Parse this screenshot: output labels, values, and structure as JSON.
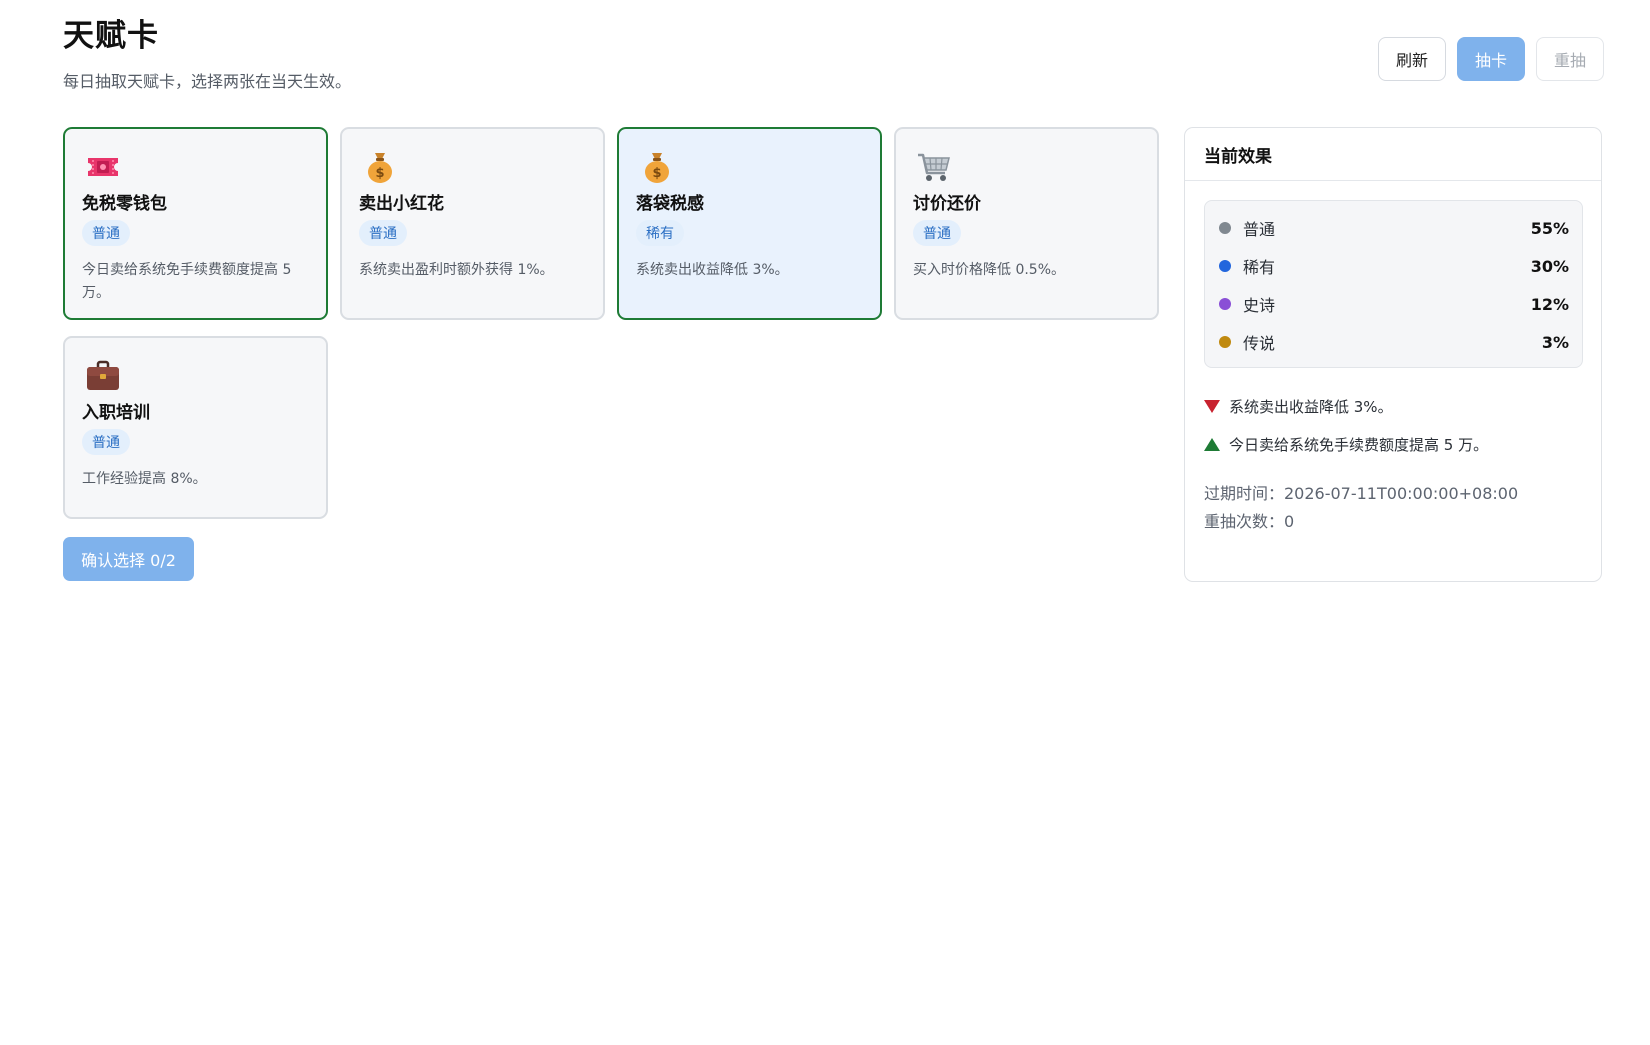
{
  "header": {
    "title": "天赋卡",
    "subtitle": "每日抽取天赋卡，选择两张在当天生效。"
  },
  "toolbar": {
    "refresh_label": "刷新",
    "draw_label": "抽卡",
    "redraw_label": "重抽"
  },
  "cards": [
    {
      "icon": "ticket-icon",
      "name": "免税零钱包",
      "rarity": "普通",
      "desc": "今日卖给系统免手续费额度提高 5 万。",
      "selected": true
    },
    {
      "icon": "money-bag-icon",
      "name": "卖出小红花",
      "rarity": "普通",
      "desc": "系统卖出盈利时额外获得 1%。",
      "selected": false
    },
    {
      "icon": "money-bag-icon",
      "name": "落袋税感",
      "rarity": "稀有",
      "desc": "系统卖出收益降低 3%。",
      "selected": true
    },
    {
      "icon": "shopping-cart-icon",
      "name": "讨价还价",
      "rarity": "普通",
      "desc": "买入时价格降低 0.5%。",
      "selected": false
    },
    {
      "icon": "briefcase-icon",
      "name": "入职培训",
      "rarity": "普通",
      "desc": "工作经验提高 8%。",
      "selected": false
    }
  ],
  "confirm": {
    "label": "确认选择 0/2"
  },
  "effects_panel": {
    "title": "当前效果",
    "odds": [
      {
        "name": "普通",
        "value": "55%",
        "color": "#808890"
      },
      {
        "name": "稀有",
        "value": "30%",
        "color": "#2266dd"
      },
      {
        "name": "史诗",
        "value": "12%",
        "color": "#8a4fd6"
      },
      {
        "name": "传说",
        "value": "3%",
        "color": "#c08a10"
      }
    ],
    "effects": [
      {
        "direction": "down",
        "text": "系统卖出收益降低 3%。"
      },
      {
        "direction": "up",
        "text": "今日卖给系统免手续费额度提高 5 万。"
      }
    ],
    "expire": "过期时间：2026-07-11T00:00:00+08:00",
    "redraw_count": "重抽次数：0"
  },
  "colors": {
    "accent": "#7fb2ec",
    "selected_border": "#1e7b35",
    "badge_bg": "#e3effc",
    "badge_text": "#2b6fc4",
    "down": "#c8222f",
    "up": "#1e7b35"
  }
}
